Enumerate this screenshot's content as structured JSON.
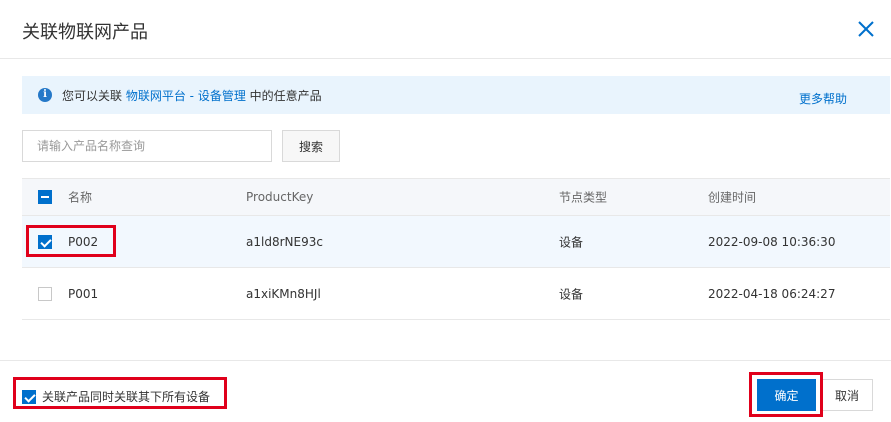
{
  "dialog": {
    "title": "关联物联网产品",
    "close_icon": "close-icon"
  },
  "info": {
    "icon": "info-icon",
    "prefix": "您可以关联 ",
    "link1": "物联网平台",
    "sep": " - ",
    "link2": "设备管理",
    "suffix": " 中的任意产品",
    "help": "更多帮助"
  },
  "search": {
    "placeholder": "请输入产品名称查询",
    "value": "",
    "button": "搜索"
  },
  "table": {
    "columns": [
      "名称",
      "ProductKey",
      "节点类型",
      "创建时间"
    ],
    "header_check": "partial",
    "rows": [
      {
        "checked": true,
        "name": "P002",
        "key": "a1ld8rNE93c",
        "type": "设备",
        "time": "2022-09-08 10:36:30"
      },
      {
        "checked": false,
        "name": "P001",
        "key": "a1xiKMn8HJl",
        "type": "设备",
        "time": "2022-04-18 06:24:27"
      }
    ]
  },
  "footer": {
    "checked": true,
    "label": "关联产品同时关联其下所有设备",
    "ok": "确定",
    "cancel": "取消"
  },
  "colors": {
    "accent": "#0070cc",
    "highlight": "#e0001b",
    "info_bg": "#e9f4fd"
  }
}
